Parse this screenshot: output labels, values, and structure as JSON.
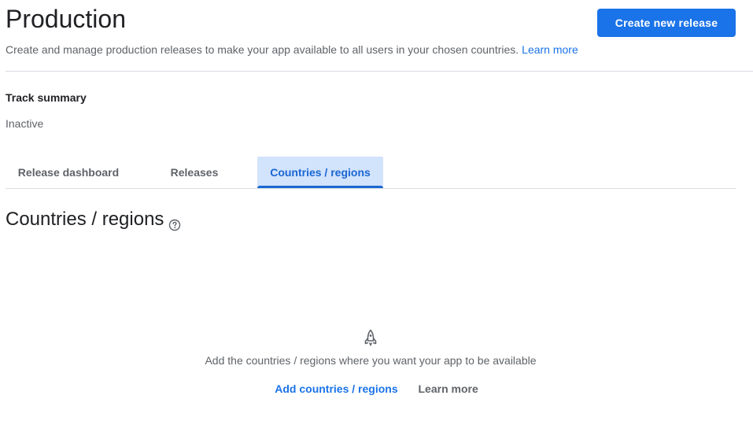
{
  "header": {
    "title": "Production",
    "primary_button": "Create new release",
    "subtitle": "Create and manage production releases to make your app available to all users in your chosen countries.",
    "learn_more": "Learn more"
  },
  "track_summary": {
    "label": "Track summary",
    "status": "Inactive"
  },
  "tabs": [
    {
      "label": "Release dashboard",
      "active": false
    },
    {
      "label": "Releases",
      "active": false
    },
    {
      "label": "Countries / regions",
      "active": true
    }
  ],
  "section": {
    "title": "Countries / regions",
    "help_icon": "help-circle-icon"
  },
  "empty_state": {
    "icon": "rocket-icon",
    "message": "Add the countries / regions where you want your app to be available",
    "primary_action": "Add countries / regions",
    "secondary_action": "Learn more"
  },
  "colors": {
    "accent": "#1a73e8",
    "active_tab_bg": "#d2e3fc",
    "active_tab_text": "#1967d2"
  }
}
